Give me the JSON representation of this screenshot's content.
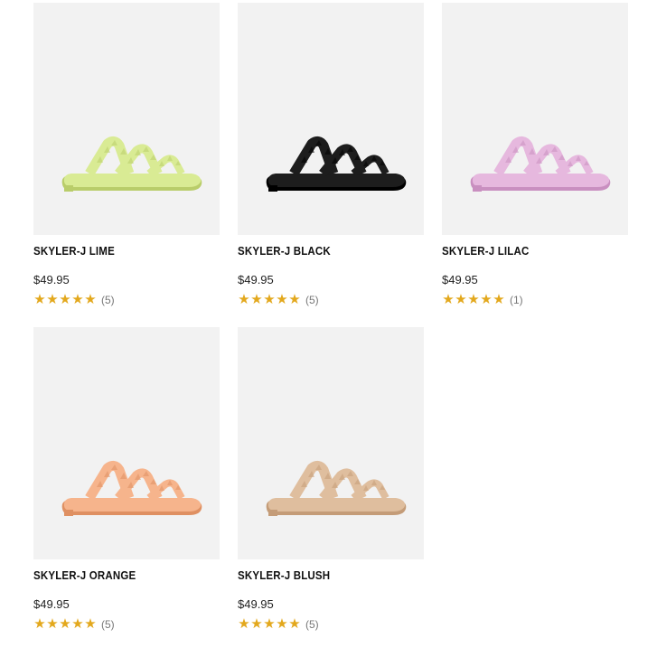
{
  "products": [
    {
      "name": "SKYLER-J LIME",
      "price": "$49.95",
      "rating": 5,
      "review_count": "(5)",
      "color": "#d9eb94",
      "shade": "#b9cd6a"
    },
    {
      "name": "SKYLER-J BLACK",
      "price": "$49.95",
      "rating": 5,
      "review_count": "(5)",
      "color": "#1d1d1d",
      "shade": "#000000"
    },
    {
      "name": "SKYLER-J LILAC",
      "price": "$49.95",
      "rating": 5,
      "review_count": "(1)",
      "color": "#e6b8de",
      "shade": "#c98fc0"
    },
    {
      "name": "SKYLER-J ORANGE",
      "price": "$49.95",
      "rating": 5,
      "review_count": "(5)",
      "color": "#f6b48c",
      "shade": "#df9062"
    },
    {
      "name": "SKYLER-J BLUSH",
      "price": "$49.95",
      "rating": 5,
      "review_count": "(5)",
      "color": "#dfbe9e",
      "shade": "#c49c78"
    }
  ],
  "star_icon": "star-icon",
  "star_color": "#e3a81d",
  "image_background": "#f2f2f2"
}
